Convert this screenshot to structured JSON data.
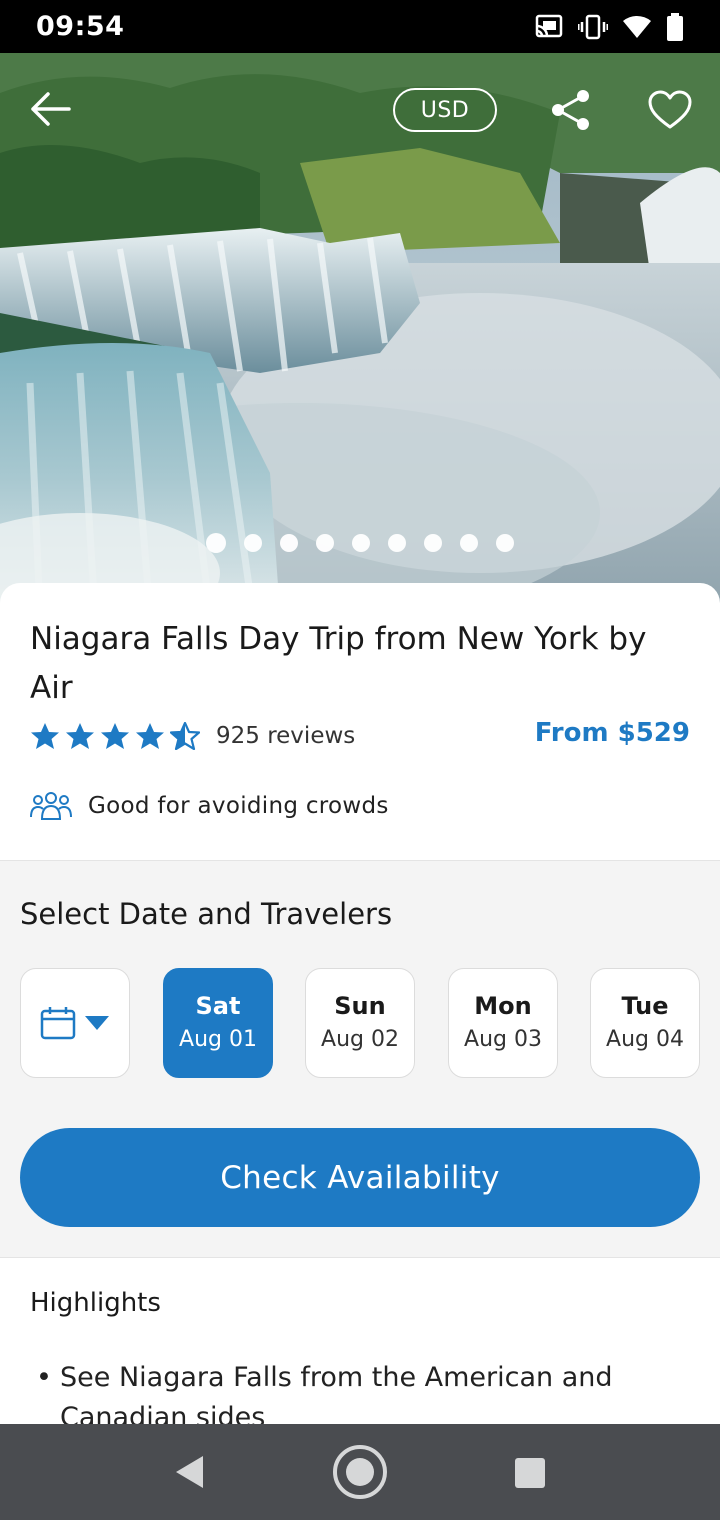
{
  "status_bar": {
    "time": "09:54"
  },
  "hero": {
    "currency_label": "USD",
    "carousel_count": 9,
    "carousel_active_index": 0
  },
  "tour": {
    "title": "Niagara Falls Day Trip from New York by Air",
    "rating": 4.5,
    "reviews": "925 reviews",
    "price": "From $529",
    "feature": "Good for avoiding crowds"
  },
  "select_section": {
    "title": "Select Date and Travelers",
    "dates": [
      {
        "day": "Sat",
        "date": "Aug 01",
        "selected": true
      },
      {
        "day": "Sun",
        "date": "Aug 02",
        "selected": false
      },
      {
        "day": "Mon",
        "date": "Aug 03",
        "selected": false
      },
      {
        "day": "Tue",
        "date": "Aug 04",
        "selected": false
      }
    ],
    "check_button": "Check Availability"
  },
  "highlights": {
    "title": "Highlights",
    "items": [
      "See Niagara Falls from the American and Canadian sides"
    ]
  },
  "colors": {
    "accent": "#1e7ac4",
    "section_bg": "#f4f4f4",
    "nav_bar": "#4a4c50"
  },
  "icons": {
    "back": "arrow-left-icon",
    "share": "share-icon",
    "favorite": "heart-icon",
    "calendar": "calendar-icon",
    "crowds": "group-icon"
  }
}
